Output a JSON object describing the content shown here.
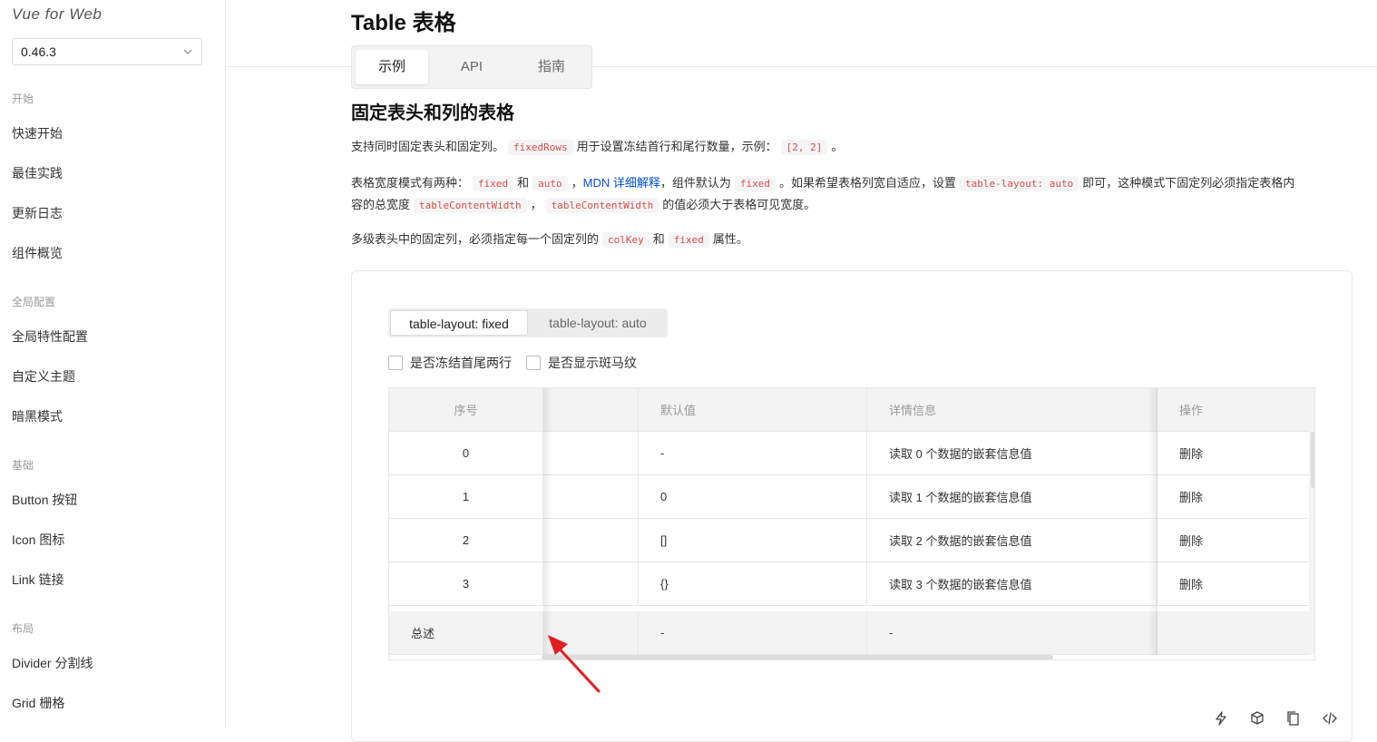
{
  "sidebar": {
    "brand": "Vue for Web",
    "version": "0.46.3",
    "groups": [
      {
        "title": "开始"
      },
      {
        "title": "全局配置"
      },
      {
        "title": "基础"
      },
      {
        "title": "布局"
      }
    ],
    "items": [
      {
        "label": "快速开始"
      },
      {
        "label": "最佳实践"
      },
      {
        "label": "更新日志"
      },
      {
        "label": "组件概览"
      },
      {
        "label": "全局特性配置"
      },
      {
        "label": "自定义主题"
      },
      {
        "label": "暗黑模式"
      },
      {
        "label": "Button 按钮"
      },
      {
        "label": "Icon 图标"
      },
      {
        "label": "Link 链接"
      },
      {
        "label": "Divider 分割线"
      },
      {
        "label": "Grid 栅格"
      }
    ]
  },
  "page": {
    "title": "Table 表格",
    "tabs": [
      {
        "label": "示例"
      },
      {
        "label": "API"
      },
      {
        "label": "指南"
      }
    ]
  },
  "section": {
    "heading": "固定表头和列的表格",
    "p1": {
      "t1": "支持同时固定表头和固定列。",
      "c1": "fixedRows",
      "t2": "用于设置冻结首行和尾行数量，示例：",
      "c2": "[2, 2]",
      "t3": "。"
    },
    "p2": {
      "t1": "表格宽度模式有两种：",
      "c1": "fixed",
      "t2": "和",
      "c2": "auto",
      "t3": "，",
      "link": "MDN 详细解释",
      "t4": "，组件默认为",
      "c3": "fixed",
      "t5": "。如果希望表格列宽自适应，设置",
      "c4": "table-layout: auto",
      "t6": "即可，这种模式下固定列必须指定表格内",
      "t7": "容的总宽度",
      "c5": "tableContentWidth",
      "t8": "，",
      "c6": "tableContentWidth",
      "t9": "的值必须大于表格可见宽度。"
    },
    "p3": {
      "t1": "多级表头中的固定列，必须指定每一个固定列的",
      "c1": "colKey",
      "t2": "和",
      "c2": "fixed",
      "t3": "属性。"
    }
  },
  "demo": {
    "layout_options": [
      {
        "label": "table-layout: fixed"
      },
      {
        "label": "table-layout: auto"
      }
    ],
    "checkboxes": [
      {
        "label": "是否冻结首尾两行"
      },
      {
        "label": "是否显示斑马纹"
      }
    ],
    "table": {
      "headers": [
        "序号",
        "",
        "默认值",
        "详情信息",
        "操作"
      ],
      "rows": [
        [
          "0",
          "",
          "-",
          "读取 0 个数据的嵌套信息值",
          "删除"
        ],
        [
          "1",
          "",
          "0",
          "读取 1 个数据的嵌套信息值",
          "删除"
        ],
        [
          "2",
          "",
          "[]",
          "读取 2 个数据的嵌套信息值",
          "删除"
        ],
        [
          "3",
          "",
          "{}",
          "读取 3 个数据的嵌套信息值",
          "删除"
        ]
      ],
      "footer": [
        "总述",
        "",
        "-",
        "-",
        ""
      ]
    }
  },
  "colors": {
    "code_text": "#e04a4a",
    "link": "#0052d9",
    "arrow": "#e02020"
  },
  "toolbar_icons": [
    "lightning-icon",
    "cube-icon",
    "copy-icon",
    "code-icon"
  ]
}
